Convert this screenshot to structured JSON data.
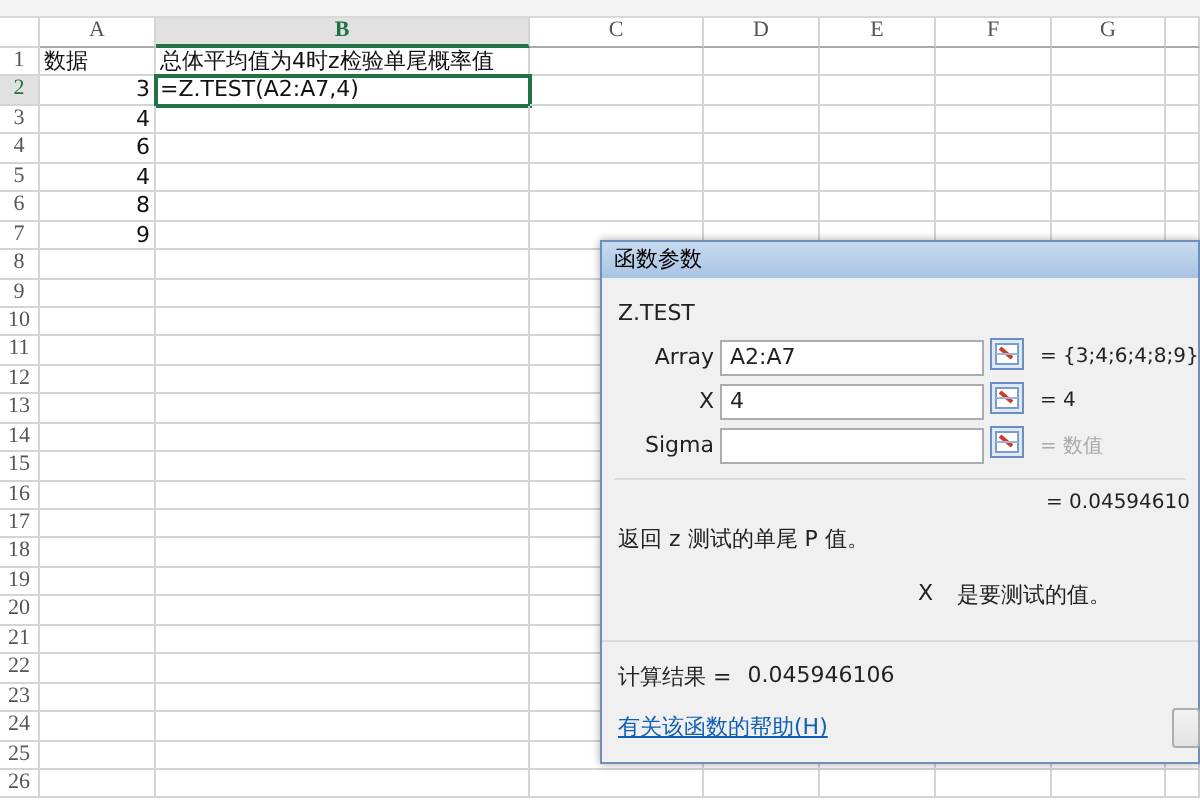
{
  "sheet": {
    "columns": [
      {
        "label": "A",
        "selected": false
      },
      {
        "label": "B",
        "selected": true
      },
      {
        "label": "C",
        "selected": false
      },
      {
        "label": "D",
        "selected": false
      },
      {
        "label": "E",
        "selected": false
      },
      {
        "label": "F",
        "selected": false
      },
      {
        "label": "G",
        "selected": false
      }
    ],
    "rows": [
      {
        "number": "1",
        "selected": false,
        "cells": [
          {
            "text": "数据",
            "kind": "text",
            "selected": false
          },
          {
            "text": "总体平均值为4时z检验单尾概率值",
            "kind": "text",
            "selected": false
          }
        ]
      },
      {
        "number": "2",
        "selected": true,
        "cells": [
          {
            "text": "3",
            "kind": "number",
            "selected": false
          },
          {
            "text": "=Z.TEST(A2:A7,4)",
            "kind": "text",
            "selected": true
          }
        ]
      },
      {
        "number": "3",
        "selected": false,
        "cells": [
          {
            "text": "4",
            "kind": "number",
            "selected": false
          }
        ]
      },
      {
        "number": "4",
        "selected": false,
        "cells": [
          {
            "text": "6",
            "kind": "number",
            "selected": false
          }
        ]
      },
      {
        "number": "5",
        "selected": false,
        "cells": [
          {
            "text": "4",
            "kind": "number",
            "selected": false
          }
        ]
      },
      {
        "number": "6",
        "selected": false,
        "cells": [
          {
            "text": "8",
            "kind": "number",
            "selected": false
          }
        ]
      },
      {
        "number": "7",
        "selected": false,
        "cells": [
          {
            "text": "9",
            "kind": "number",
            "selected": false
          }
        ]
      },
      {
        "number": "8",
        "selected": false
      },
      {
        "number": "9",
        "selected": false
      },
      {
        "number": "10",
        "selected": false
      },
      {
        "number": "11",
        "selected": false
      },
      {
        "number": "12",
        "selected": false
      },
      {
        "number": "13",
        "selected": false
      },
      {
        "number": "14",
        "selected": false
      },
      {
        "number": "15",
        "selected": false
      },
      {
        "number": "16",
        "selected": false
      },
      {
        "number": "17",
        "selected": false
      },
      {
        "number": "18",
        "selected": false
      },
      {
        "number": "19",
        "selected": false
      },
      {
        "number": "20",
        "selected": false
      },
      {
        "number": "21",
        "selected": false
      },
      {
        "number": "22",
        "selected": false
      },
      {
        "number": "23",
        "selected": false
      },
      {
        "number": "24",
        "selected": false
      },
      {
        "number": "25",
        "selected": false
      },
      {
        "number": "26",
        "selected": false
      }
    ]
  },
  "dialog": {
    "title": "函数参数",
    "function_name": "Z.TEST",
    "arguments": [
      {
        "label": "Array",
        "value": "A2:A7",
        "result": "= {3;4;6;4;8;9}",
        "result_dimmed": false
      },
      {
        "label": "X",
        "value": "4",
        "result": "= 4",
        "result_dimmed": false
      },
      {
        "label": "Sigma",
        "result": "= 数值",
        "result_dimmed": true
      }
    ],
    "formula_result": "= 0.04594610",
    "description": "返回 z 测试的单尾 P 值。",
    "argument_name": "X",
    "argument_help": "是要测试的值。",
    "calc_label": "计算结果 =",
    "calc_value": "0.045946106",
    "help_link": "有关该函数的帮助(H)"
  }
}
